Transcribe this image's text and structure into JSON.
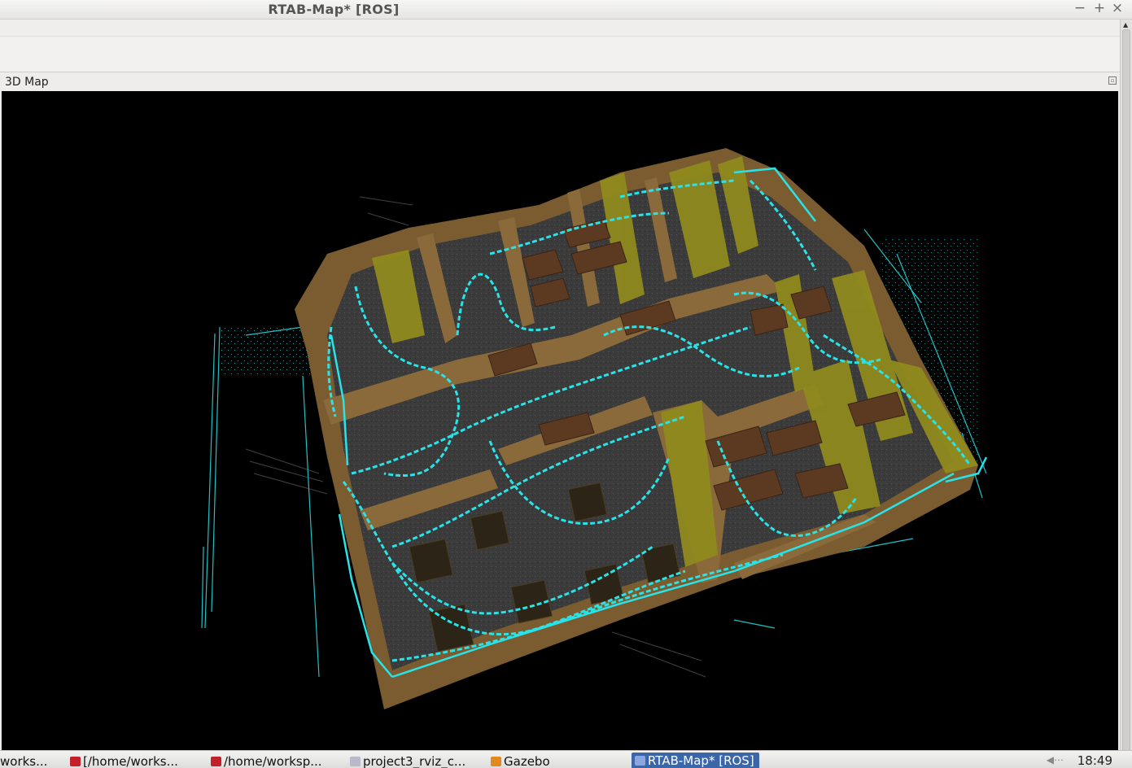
{
  "window": {
    "title": "RTAB-Map* [ROS]",
    "minimize": "−",
    "maximize": "+",
    "close": "×"
  },
  "dock": {
    "title": "3D Map",
    "float_icon": "float-icon"
  },
  "viewport": {
    "background": "#000000",
    "colors": {
      "wall_brown": "#8a6a3a",
      "wall_olive": "#8f8a1e",
      "floor": "#3a3a3a",
      "trajectory": "#29e3e8",
      "furniture": "#5c3a22"
    }
  },
  "taskbar": {
    "items": [
      {
        "label": "works...",
        "icon": "terminal-icon"
      },
      {
        "label": "[/home/works...",
        "icon": "terminal-icon"
      },
      {
        "label": "/home/worksp...",
        "icon": "terminal-icon"
      },
      {
        "label": "project3_rviz_c...",
        "icon": "rviz-icon"
      },
      {
        "label": "Gazebo",
        "icon": "gazebo-icon"
      },
      {
        "label": "RTAB-Map* [ROS]",
        "icon": "rtabmap-icon",
        "active": true
      }
    ],
    "clock": "18:49",
    "volume_icon": "volume-icon"
  }
}
